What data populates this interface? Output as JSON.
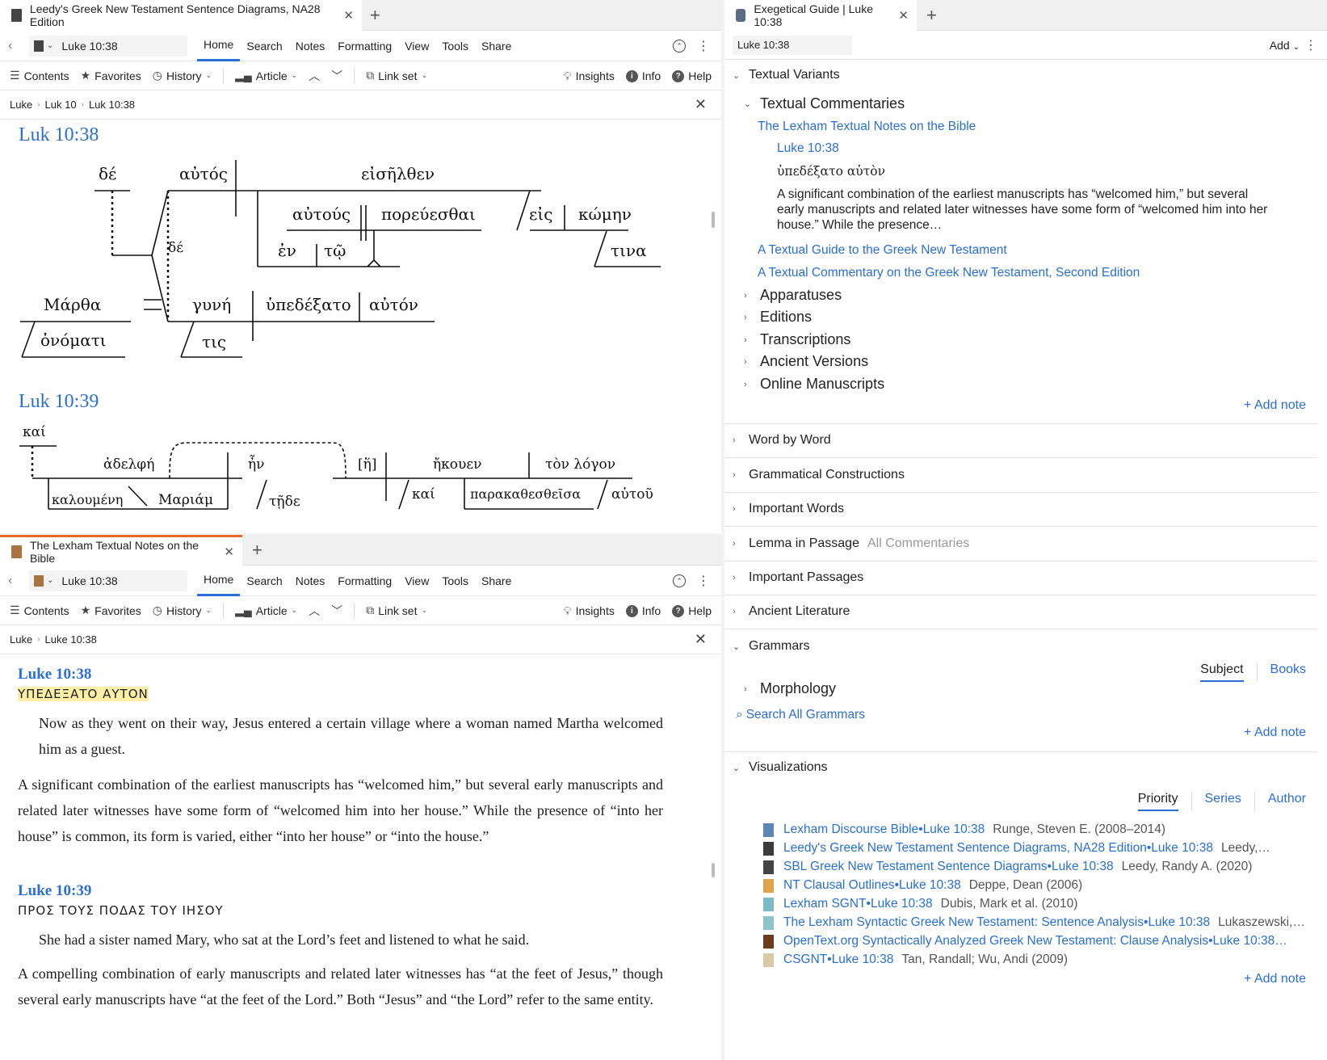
{
  "left_top": {
    "tab_title": "Leedy's Greek New Testament Sentence Diagrams, NA28 Edition",
    "reference": "Luke 10:38",
    "menu": [
      "Home",
      "Search",
      "Notes",
      "Formatting",
      "View",
      "Tools",
      "Share"
    ],
    "toolbar": {
      "contents": "Contents",
      "favorites": "Favorites",
      "history": "History",
      "article": "Article",
      "link_set": "Link set",
      "insights": "Insights",
      "info": "Info",
      "help": "Help"
    },
    "breadcrumb": [
      "Luke",
      "Luk 10",
      "Luk 10:38"
    ],
    "verse1": "Luk 10:38",
    "verse2": "Luk 10:39",
    "diagram1": {
      "de": "δέ",
      "autos": "αὐτός",
      "eiselthen": "εἰσῆλθεν",
      "autous": "αὐτούς",
      "poreuesthai": "πορεύεσθαι",
      "eis": "εἰς",
      "komen": "κώμην",
      "en": "ἐν",
      "to": "τῷ",
      "tina": "τινα",
      "de2": "δέ",
      "martha": "Μάρθα",
      "gyne": "γυνή",
      "hypedexato": "ὑπεδέξατο",
      "auton": "αὐτόν",
      "onomati": "ὀνόματι",
      "tis": "τις"
    },
    "diagram2": {
      "kai": "καί",
      "adelphe": "ἀδελφή",
      "en": "ἦν",
      "he": "[ἥ]",
      "ekouen": "ἤκουεν",
      "ton_logon": "τὸν λόγον",
      "kaloumene": "καλουμένη",
      "mariam": "Μαριάμ",
      "tede": "τῇδε",
      "kai2": "καί",
      "parakathestheisa": "παρακαθεσθεῖσα",
      "autou": "αὐτοῦ"
    }
  },
  "left_bottom": {
    "tab_title": "The Lexham Textual Notes on the Bible",
    "reference": "Luke 10:38",
    "menu": [
      "Home",
      "Search",
      "Notes",
      "Formatting",
      "View",
      "Tools",
      "Share"
    ],
    "toolbar": {
      "contents": "Contents",
      "favorites": "Favorites",
      "history": "History",
      "article": "Article",
      "link_set": "Link set",
      "insights": "Insights",
      "info": "Info",
      "help": "Help"
    },
    "breadcrumb": [
      "Luke",
      "Luke 10:38"
    ],
    "notes": [
      {
        "ref": "Luke 10:38",
        "lemma": "ΥΠΕΔΕΞΑΤΟ ΑΥΤΟΝ",
        "translation": "Now as they went on their way, Jesus entered a certain village where a woman named Martha welcomed him as a guest.",
        "comment": "A significant combination of the earliest manuscripts has “welcomed him,” but several early manuscripts and related later witnesses have some form of “welcomed him into her house.” While the presence of “into her house” is common, its form is varied, either “into her house” or “into the house.”"
      },
      {
        "ref": "Luke 10:39",
        "lemma": "ΠΡΟΣ ΤΟΥΣ ΠΟΔΑΣ ΤΟΥ ΙΗΣΟΥ",
        "translation": "She had a sister named Mary, who sat at the Lord’s feet and listened to what he said.",
        "comment": "A compelling combination of early manuscripts and related later witnesses has “at the feet of Jesus,” though several early manuscripts have “at the feet of the Lord.” Both “Jesus” and “the Lord” refer to the same entity."
      }
    ]
  },
  "right": {
    "tab_title": "Exegetical Guide | Luke 10:38",
    "reference": "Luke 10:38",
    "add_label": "Add",
    "textual_variants": "Textual Variants",
    "textual_commentaries": "Textual Commentaries",
    "lexham_title": "The Lexham Textual Notes on the Bible",
    "lexham_ref": "Luke 10:38",
    "lexham_lemma": "ὑπεδέξατο αὐτὸν",
    "lexham_excerpt": "A significant combination of the earliest manuscripts has “welcomed him,” but several early manuscripts and related later witnesses have some form of “welcomed him into her house.” While the presence…",
    "other_commentaries": [
      "A Textual Guide to the Greek New Testament",
      "A Textual Commentary on the Greek New Testament, Second Edition"
    ],
    "subsections": [
      "Apparatuses",
      "Editions",
      "Transcriptions",
      "Ancient Versions",
      "Online Manuscripts"
    ],
    "add_note": "+ Add note",
    "sections": [
      "Word by Word",
      "Grammatical Constructions",
      "Important Words",
      "Lemma in Passage",
      "Important Passages",
      "Ancient Literature"
    ],
    "lemma_muted": "All Commentaries",
    "grammars": "Grammars",
    "grammar_tabs": [
      "Subject",
      "Books"
    ],
    "morphology": "Morphology",
    "search_grammars": "Search All Grammars",
    "visualizations": "Visualizations",
    "vis_tabs": [
      "Priority",
      "Series",
      "Author"
    ],
    "vis_items": [
      {
        "title": "Lexham Discourse Bible",
        "ref": "Luke 10:38",
        "author": "Runge, Steven E. (2008–2014)",
        "color": "#5b86b5"
      },
      {
        "title": "Leedy's Greek New Testament Sentence Diagrams, NA28 Edition",
        "ref": "Luke 10:38",
        "author": "Leedy,…",
        "color": "#3c3c3c"
      },
      {
        "title": "SBL Greek New Testament Sentence Diagrams",
        "ref": "Luke 10:38",
        "author": "Leedy, Randy A. (2020)",
        "color": "#444"
      },
      {
        "title": "NT Clausal Outlines",
        "ref": "Luke 10:38",
        "author": "Deppe, Dean (2006)",
        "color": "#e0a54a"
      },
      {
        "title": "Lexham SGNT",
        "ref": "Luke 10:38",
        "author": "Dubis, Mark et al. (2010)",
        "color": "#7bbcc6"
      },
      {
        "title": "The Lexham Syntactic Greek New Testament: Sentence Analysis",
        "ref": "Luke 10:38",
        "author": "Lukaszewski,…",
        "color": "#8cc3cc"
      },
      {
        "title": "OpenText.org Syntactically Analyzed Greek New Testament: Clause Analysis",
        "ref": "Luke 10:38…",
        "author": "",
        "color": "#6b3d1d"
      },
      {
        "title": "CSGNT",
        "ref": "Luke 10:38",
        "author": "Tan, Randall; Wu, Andi (2009)",
        "color": "#d9c9a8"
      }
    ]
  }
}
